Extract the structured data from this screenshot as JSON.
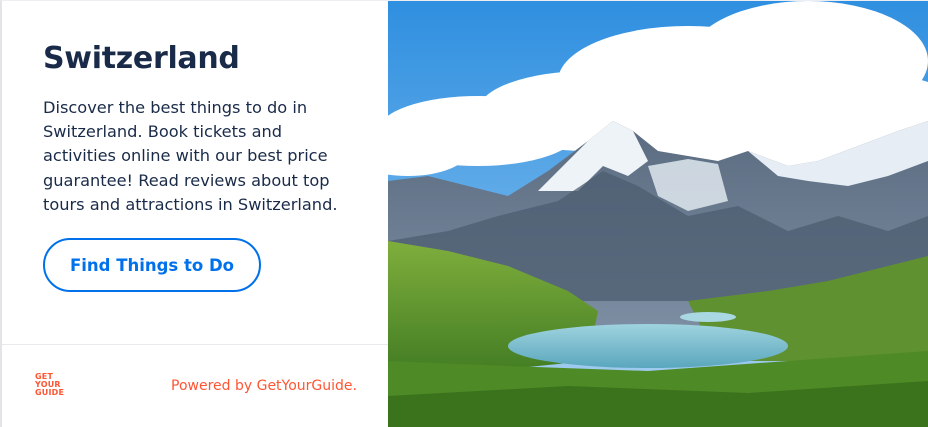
{
  "widget": {
    "title": "Switzerland",
    "description": "Discover the best things to do in Switzerland. Book tickets and activities online with our best price guarantee! Read reviews about top tours and attractions in Switzerland.",
    "cta_label": "Find Things to Do",
    "logo_lines": [
      "GET",
      "YOUR",
      "GUIDE"
    ],
    "powered_by": "Powered by GetYourGuide.",
    "image": "alpine-lake-mountain-landscape"
  },
  "colors": {
    "title": "#1a2b49",
    "cta": "#0071eb",
    "brand": "#ff5533"
  }
}
